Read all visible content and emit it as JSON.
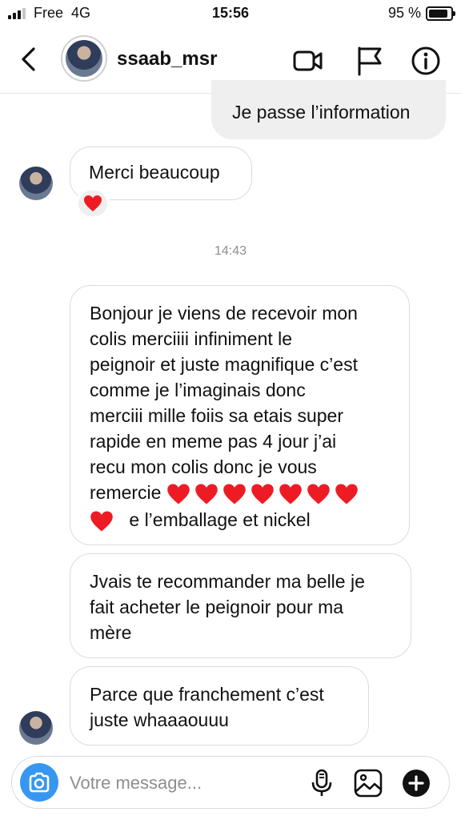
{
  "status_bar": {
    "carrier": "Free",
    "network": "4G",
    "time": "15:56",
    "battery": "95 %"
  },
  "header": {
    "username": "ssaab_msr"
  },
  "messages": [
    {
      "direction": "outgoing",
      "text": "Je passe l’information"
    },
    {
      "direction": "incoming",
      "text": "Merci beaucoup",
      "reaction": "heart"
    },
    {
      "direction": "incoming",
      "text_lines": [
        "Bonjour je viens de recevoir mon",
        "colis merciiii infiniment le",
        "peignoir et juste magnifique c’est",
        "comme je l’imaginais donc",
        "merciii mille foiis sa etais super",
        "rapide en meme pas 4 jour j’ai",
        "recu mon colis donc je vous"
      ],
      "remercie": "remercie",
      "heart_count_line1": 7,
      "tail": "e l’emballage et nickel"
    },
    {
      "direction": "incoming",
      "text": "Jvais te recommander ma belle je\nfait acheter le peignoir pour ma\nmère"
    },
    {
      "direction": "incoming",
      "text": "Parce que franchement c’est\njuste whaaaouuu"
    }
  ],
  "timestamp": "14:43",
  "composer": {
    "placeholder": "Votre message..."
  },
  "colors": {
    "accent": "#3797f0",
    "heart": "#ed1c24",
    "outgoing_bubble": "#efefef"
  },
  "icons": [
    "back-icon",
    "video-call-icon",
    "flag-icon",
    "info-icon",
    "camera-icon",
    "microphone-icon",
    "gallery-icon",
    "plus-icon",
    "heart-icon"
  ]
}
